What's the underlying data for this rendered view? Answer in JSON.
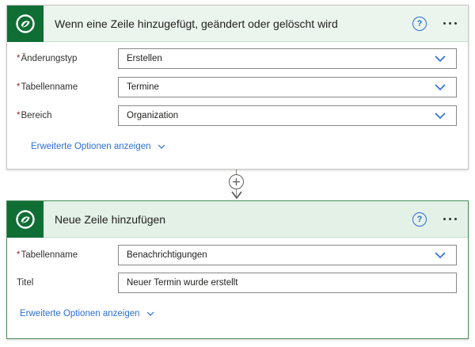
{
  "trigger": {
    "title": "Wenn eine Zeile hinzugefügt, geändert oder gelöscht wird",
    "help_icon": "question-circle-icon",
    "help_glyph": "?",
    "more_icon": "ellipsis-icon",
    "fields": [
      {
        "label": "Änderungstyp",
        "required": true,
        "value": "Erstellen",
        "type": "dropdown"
      },
      {
        "label": "Tabellenname",
        "required": true,
        "value": "Termine",
        "type": "dropdown"
      },
      {
        "label": "Bereich",
        "required": true,
        "value": "Organization",
        "type": "dropdown"
      }
    ],
    "advanced_link": "Erweiterte Optionen anzeigen"
  },
  "connector": {
    "add_icon": "plus-icon",
    "arrow_icon": "arrow-down-icon"
  },
  "action": {
    "title": "Neue Zeile hinzufügen",
    "help_icon": "question-circle-icon",
    "help_glyph": "?",
    "more_icon": "ellipsis-icon",
    "fields": [
      {
        "label": "Tabellenname",
        "required": true,
        "value": "Benachrichtigungen",
        "type": "dropdown"
      },
      {
        "label": "Titel",
        "required": false,
        "value": "Neuer Termin wurde erstellt",
        "type": "text"
      }
    ],
    "advanced_link": "Erweiterte Optionen anzeigen"
  },
  "colors": {
    "brand": "#0f6e34",
    "link": "#2b6fd6",
    "required": "#a4262c",
    "header_bg": "#ebf5ee"
  },
  "required_marker": "*"
}
